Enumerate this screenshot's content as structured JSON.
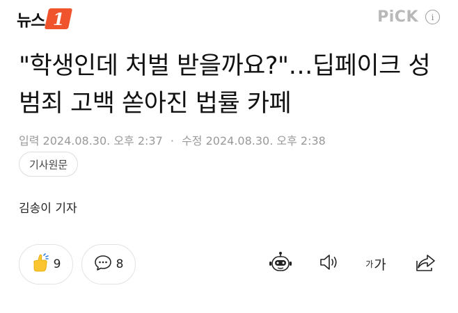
{
  "header": {
    "logo_text": "뉴스",
    "logo_badge": "1",
    "pick_label": "PiCK",
    "info_icon": "i"
  },
  "article": {
    "title": "\"학생인데 처벌 받을까요?\"…딥페이크 성범죄 고백 쏟아진 법률 카페",
    "meta_input_label": "입력",
    "meta_input_time": "2024.08.30. 오후 2:37",
    "meta_separator": "·",
    "meta_edit_label": "수정",
    "meta_edit_time": "2024.08.30. 오후 2:38",
    "source_button": "기사원문",
    "reporter": "김송이 기자"
  },
  "actions": {
    "like_count": "9",
    "comment_count": "8",
    "font_size_small": "가",
    "font_size_large": "가"
  },
  "colors": {
    "brand": "#f0542d",
    "meta_text": "#999999",
    "pick_text": "#b8b8b8"
  },
  "icons": [
    "thumbs-up-icon",
    "comment-icon",
    "robot-summary-icon",
    "speaker-icon",
    "font-size-icon",
    "share-icon",
    "info-icon"
  ]
}
